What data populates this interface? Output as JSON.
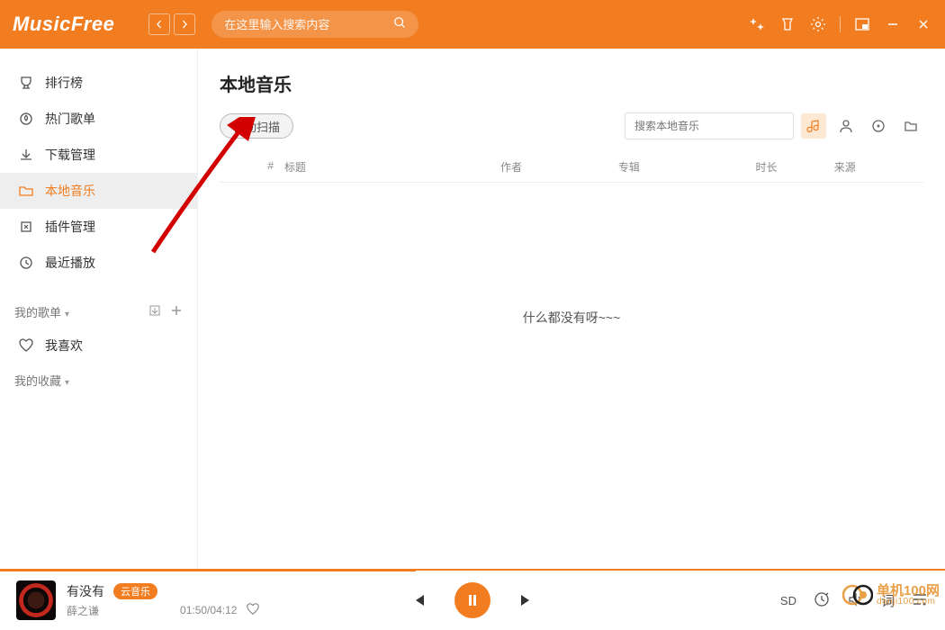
{
  "app": {
    "title": "MusicFree"
  },
  "header": {
    "search_placeholder": "在这里输入搜索内容"
  },
  "sidebar": {
    "items": [
      {
        "label": "排行榜",
        "icon": "trophy"
      },
      {
        "label": "热门歌单",
        "icon": "hot"
      },
      {
        "label": "下载管理",
        "icon": "download"
      },
      {
        "label": "本地音乐",
        "icon": "folder",
        "active": true
      },
      {
        "label": "插件管理",
        "icon": "plugin"
      },
      {
        "label": "最近播放",
        "icon": "clock"
      }
    ],
    "section_playlist": "我的歌单",
    "favorite_label": "我喜欢",
    "section_collection": "我的收藏"
  },
  "main": {
    "title": "本地音乐",
    "scan_label": "自动扫描",
    "local_search_placeholder": "搜索本地音乐",
    "columns": {
      "index": "#",
      "title": "标题",
      "author": "作者",
      "album": "专辑",
      "duration": "时长",
      "source": "来源"
    },
    "empty_text": "什么都没有呀~~~"
  },
  "player": {
    "track_title": "有没有",
    "artist": "薛之谦",
    "badge": "云音乐",
    "elapsed": "01:50",
    "total": "04:12",
    "quality": "SD",
    "lyrics_label": "词"
  },
  "watermark": {
    "line1": "单机100网",
    "line2": "danji100.com"
  }
}
